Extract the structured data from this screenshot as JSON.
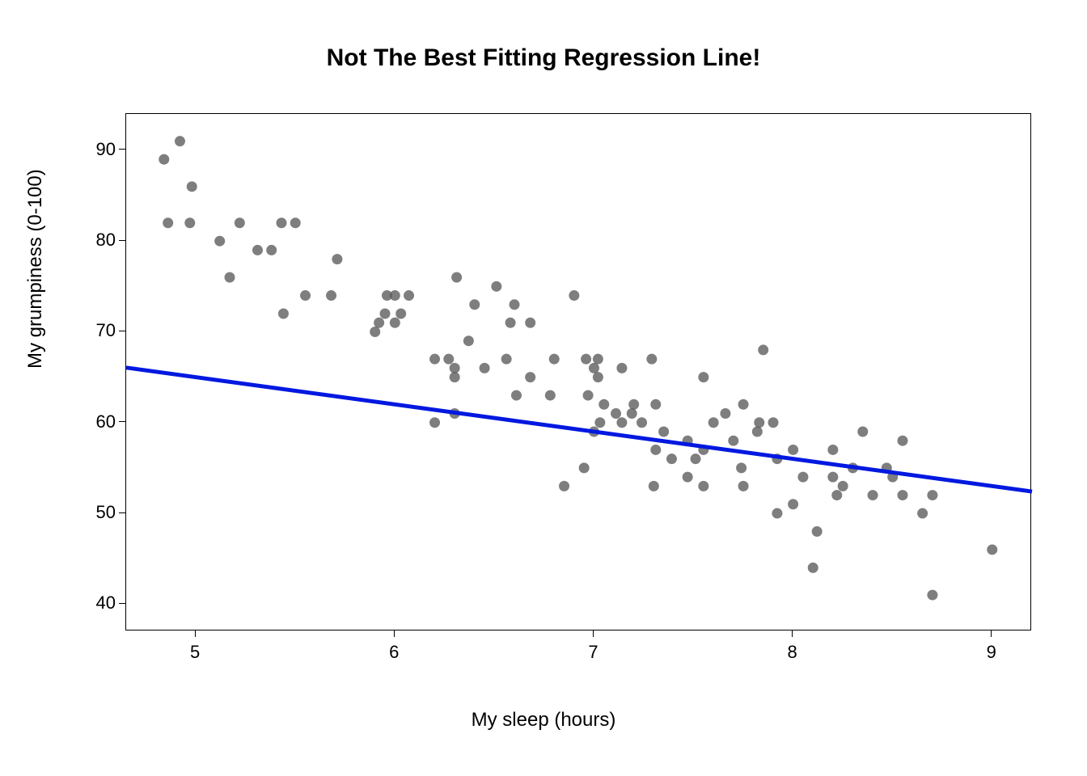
{
  "chart_data": {
    "type": "scatter",
    "title": "Not The Best Fitting Regression Line!",
    "xlabel": "My sleep (hours)",
    "ylabel": "My grumpiness (0-100)",
    "xlim": [
      4.65,
      9.2
    ],
    "ylim": [
      37,
      94
    ],
    "xticks": [
      5,
      6,
      7,
      8,
      9
    ],
    "yticks": [
      40,
      50,
      60,
      70,
      80,
      90
    ],
    "series": [
      {
        "name": "data",
        "points": [
          [
            4.84,
            89
          ],
          [
            4.86,
            82
          ],
          [
            4.92,
            91
          ],
          [
            4.97,
            82
          ],
          [
            4.98,
            86
          ],
          [
            5.12,
            80
          ],
          [
            5.17,
            76
          ],
          [
            5.22,
            82
          ],
          [
            5.31,
            79
          ],
          [
            5.38,
            79
          ],
          [
            5.43,
            82
          ],
          [
            5.44,
            72
          ],
          [
            5.5,
            82
          ],
          [
            5.55,
            74
          ],
          [
            5.68,
            74
          ],
          [
            5.71,
            78
          ],
          [
            5.9,
            70
          ],
          [
            5.92,
            71
          ],
          [
            5.95,
            72
          ],
          [
            5.96,
            74
          ],
          [
            6.0,
            74
          ],
          [
            6.0,
            71
          ],
          [
            6.03,
            72
          ],
          [
            6.07,
            74
          ],
          [
            6.2,
            67
          ],
          [
            6.2,
            60
          ],
          [
            6.27,
            67
          ],
          [
            6.3,
            61
          ],
          [
            6.3,
            65
          ],
          [
            6.3,
            66
          ],
          [
            6.31,
            76
          ],
          [
            6.37,
            69
          ],
          [
            6.4,
            73
          ],
          [
            6.45,
            66
          ],
          [
            6.51,
            75
          ],
          [
            6.56,
            67
          ],
          [
            6.58,
            71
          ],
          [
            6.6,
            73
          ],
          [
            6.61,
            63
          ],
          [
            6.68,
            65
          ],
          [
            6.68,
            71
          ],
          [
            6.78,
            63
          ],
          [
            6.8,
            67
          ],
          [
            6.85,
            53
          ],
          [
            6.9,
            74
          ],
          [
            6.95,
            55
          ],
          [
            6.97,
            63
          ],
          [
            6.96,
            67
          ],
          [
            7.0,
            66
          ],
          [
            7.0,
            59
          ],
          [
            7.02,
            67
          ],
          [
            7.03,
            60
          ],
          [
            7.02,
            65
          ],
          [
            7.05,
            62
          ],
          [
            7.11,
            61
          ],
          [
            7.14,
            66
          ],
          [
            7.14,
            60
          ],
          [
            7.19,
            61
          ],
          [
            7.2,
            62
          ],
          [
            7.24,
            60
          ],
          [
            7.29,
            67
          ],
          [
            7.3,
            53
          ],
          [
            7.31,
            57
          ],
          [
            7.31,
            62
          ],
          [
            7.35,
            59
          ],
          [
            7.39,
            56
          ],
          [
            7.47,
            54
          ],
          [
            7.47,
            58
          ],
          [
            7.51,
            56
          ],
          [
            7.55,
            53
          ],
          [
            7.55,
            57
          ],
          [
            7.55,
            65
          ],
          [
            7.6,
            60
          ],
          [
            7.66,
            61
          ],
          [
            7.7,
            58
          ],
          [
            7.74,
            55
          ],
          [
            7.75,
            53
          ],
          [
            7.82,
            59
          ],
          [
            7.75,
            62
          ],
          [
            7.85,
            68
          ],
          [
            7.83,
            60
          ],
          [
            7.9,
            60
          ],
          [
            7.92,
            50
          ],
          [
            7.92,
            56
          ],
          [
            8.0,
            51
          ],
          [
            8.0,
            57
          ],
          [
            8.05,
            54
          ],
          [
            8.1,
            44
          ],
          [
            8.12,
            48
          ],
          [
            8.2,
            54
          ],
          [
            8.2,
            57
          ],
          [
            8.22,
            52
          ],
          [
            8.25,
            53
          ],
          [
            8.3,
            55
          ],
          [
            8.35,
            59
          ],
          [
            8.4,
            52
          ],
          [
            8.47,
            55
          ],
          [
            8.5,
            54
          ],
          [
            8.55,
            58
          ],
          [
            8.55,
            52
          ],
          [
            8.65,
            50
          ],
          [
            8.7,
            52
          ],
          [
            8.7,
            41
          ],
          [
            9.0,
            46
          ]
        ]
      }
    ],
    "line": {
      "slope": -3.0,
      "intercept": 80.0
    },
    "line_color": "#0018e0",
    "point_color": "rgba(90,90,90,0.78)"
  }
}
